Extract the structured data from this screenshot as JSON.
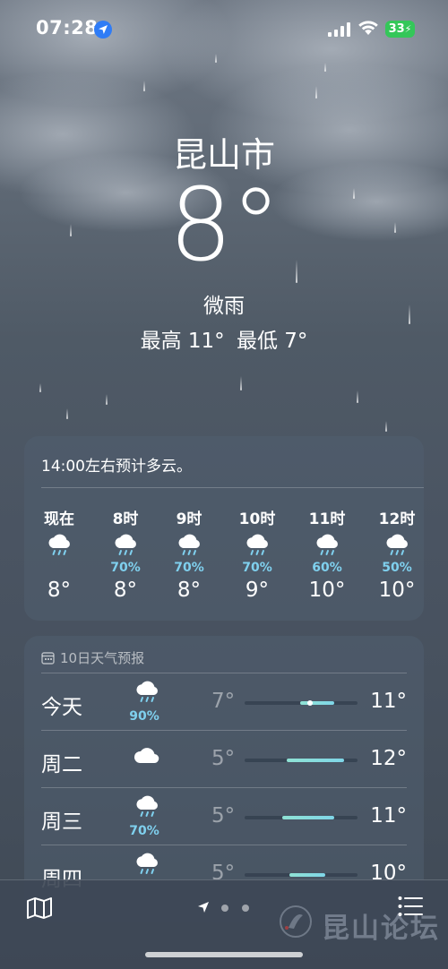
{
  "status_bar": {
    "time": "07:28",
    "battery": "33",
    "colors": {
      "battery": "#34c759",
      "location": "#2f7cf6"
    }
  },
  "header": {
    "city": "昆山市",
    "temperature": "8°",
    "condition": "微雨",
    "high": "最高 11°",
    "low": "最低 7°"
  },
  "hourly": {
    "summary": "14:00左右预计多云。",
    "items": [
      {
        "label": "现在",
        "icon": "rain-cloud-icon",
        "pop": "",
        "temp": "8°"
      },
      {
        "label": "8时",
        "icon": "rain-cloud-icon",
        "pop": "70%",
        "temp": "8°"
      },
      {
        "label": "9时",
        "icon": "rain-cloud-icon",
        "pop": "70%",
        "temp": "8°"
      },
      {
        "label": "10时",
        "icon": "rain-cloud-icon",
        "pop": "70%",
        "temp": "9°"
      },
      {
        "label": "11时",
        "icon": "rain-cloud-icon",
        "pop": "60%",
        "temp": "10°"
      },
      {
        "label": "12时",
        "icon": "rain-cloud-icon",
        "pop": "50%",
        "temp": "10°"
      }
    ]
  },
  "daily": {
    "header": "10日天气预报",
    "days": [
      {
        "name": "今天",
        "icon": "rain-cloud-icon",
        "pop": "90%",
        "low": "7°",
        "high": "11°",
        "current_marker": true
      },
      {
        "name": "周二",
        "icon": "cloud-icon",
        "pop": "",
        "low": "5°",
        "high": "12°",
        "current_marker": false
      },
      {
        "name": "周三",
        "icon": "rain-cloud-icon",
        "pop": "70%",
        "low": "5°",
        "high": "11°",
        "current_marker": false
      },
      {
        "name": "周四",
        "icon": "rain-cloud-icon",
        "pop": "",
        "low": "5°",
        "high": "10°",
        "current_marker": false
      }
    ],
    "range_colors": {
      "bar": "#8fe2d4",
      "pop_text": "#7fd0ee"
    }
  },
  "toolbar": {
    "page_count": 3,
    "current_page": 0
  },
  "watermark": {
    "text": "昆山论坛"
  }
}
